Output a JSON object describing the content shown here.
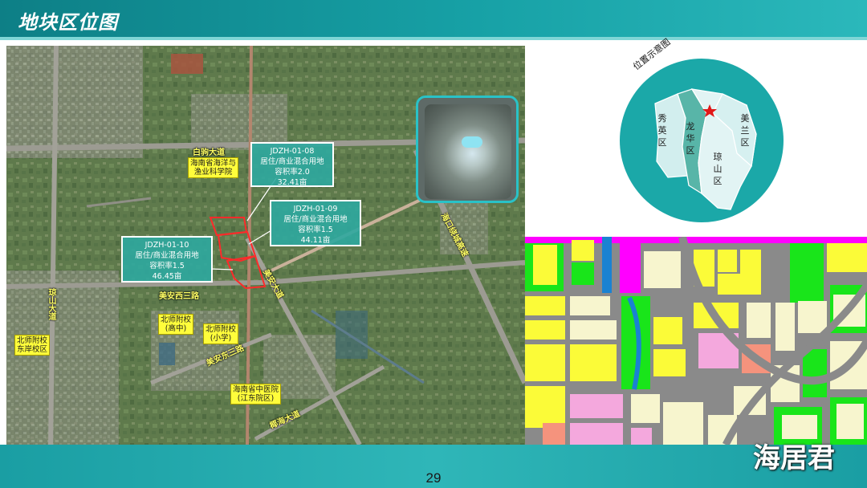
{
  "header": {
    "title": "地块区位图"
  },
  "footer": {
    "page_number": "29",
    "watermark": "海居君"
  },
  "satellite": {
    "roads": {
      "r1": "白驹大道",
      "r2": "美安西三路",
      "r3": "琼山大道",
      "r4": "海口绕城高速",
      "r5": "美安东三路",
      "r6": "美安大道",
      "r7": "椰海大道"
    },
    "tags": {
      "t1": [
        "海南省海洋与",
        "渔业科学院"
      ],
      "t2": [
        "北师附校",
        "(高中)"
      ],
      "t3": [
        "北师附校",
        "(小学)"
      ],
      "t4": [
        "北师附校",
        "东岸校区"
      ],
      "t5": [
        "海南省中医院",
        "(江东院区)"
      ]
    },
    "parcels": [
      {
        "code": "JDZH-01-08",
        "use": "居住/商业混合用地",
        "far": "容积率2.0",
        "area": "32.41亩"
      },
      {
        "code": "JDZH-01-09",
        "use": "居住/商业混合用地",
        "far": "容积率1.5",
        "area": "44.11亩"
      },
      {
        "code": "JDZH-01-10",
        "use": "居住/商业混合用地",
        "far": "容积率1.5",
        "area": "46.45亩"
      }
    ]
  },
  "location_map": {
    "title": "位置示意图",
    "districts": {
      "xiuying": "秀英区",
      "longhua": "龙华区",
      "qiongshan": "琼山区",
      "meilan": "美兰区"
    },
    "colors": {
      "ring": "#1ba8a8",
      "xiuying": "#d2eeee",
      "longhua": "#58b5a8",
      "qiongshan": "#e2f4f4",
      "meilan": "#d6f0f0",
      "marker": "#e01818"
    }
  },
  "planning_map": {
    "colors": {
      "road": "#8a8a8a",
      "residential": "#fbfb38",
      "commercial": "#ff00ff",
      "mixed": "#f4a8dd",
      "green": "#19e51a",
      "public": "#f7f5ce",
      "water": "#1a82d2",
      "special": "#f5937d"
    }
  }
}
